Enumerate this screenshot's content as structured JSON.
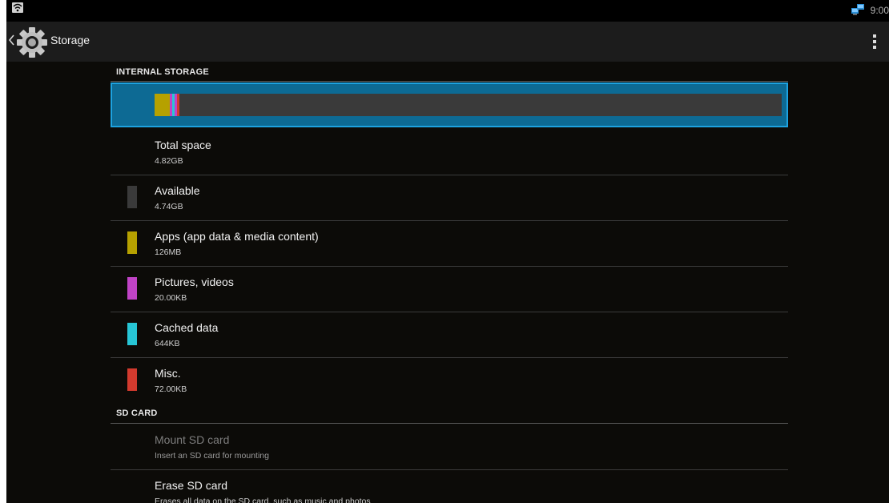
{
  "status_bar": {
    "time": "9:00",
    "wifi_icon": "wifi-icon",
    "network_icon": "network-computers-icon"
  },
  "action_bar": {
    "title": "Storage",
    "back_icon": "chevron-left-icon",
    "app_icon": "settings-gear-icon",
    "overflow_icon": "overflow-menu-icon"
  },
  "internal_storage": {
    "header": "INTERNAL STORAGE",
    "usage_bar": {
      "track_color": "#3a3a3a",
      "segments": [
        {
          "name": "apps",
          "color": "#b6a100"
        },
        {
          "name": "pictures",
          "color": "#c043c6"
        },
        {
          "name": "cached",
          "color": "#27c6d6"
        },
        {
          "name": "misc",
          "color": "#d23a2e"
        }
      ]
    },
    "items": [
      {
        "title": "Total space",
        "summary": "4.82GB"
      },
      {
        "title": "Available",
        "summary": "4.74GB",
        "color": "#3a3a3a"
      },
      {
        "title": "Apps (app data & media content)",
        "summary": "126MB",
        "color": "#b6a100"
      },
      {
        "title": "Pictures, videos",
        "summary": "20.00KB",
        "color": "#c043c6"
      },
      {
        "title": "Cached data",
        "summary": "644KB",
        "color": "#27c6d6"
      },
      {
        "title": "Misc.",
        "summary": "72.00KB",
        "color": "#d23a2e"
      }
    ]
  },
  "sd_card": {
    "header": "SD CARD",
    "items": [
      {
        "title": "Mount SD card",
        "summary": "Insert an SD card for mounting",
        "enabled": false
      },
      {
        "title": "Erase SD card",
        "summary": "Erases all data on the SD card, such as music and photos",
        "enabled": true
      }
    ]
  }
}
